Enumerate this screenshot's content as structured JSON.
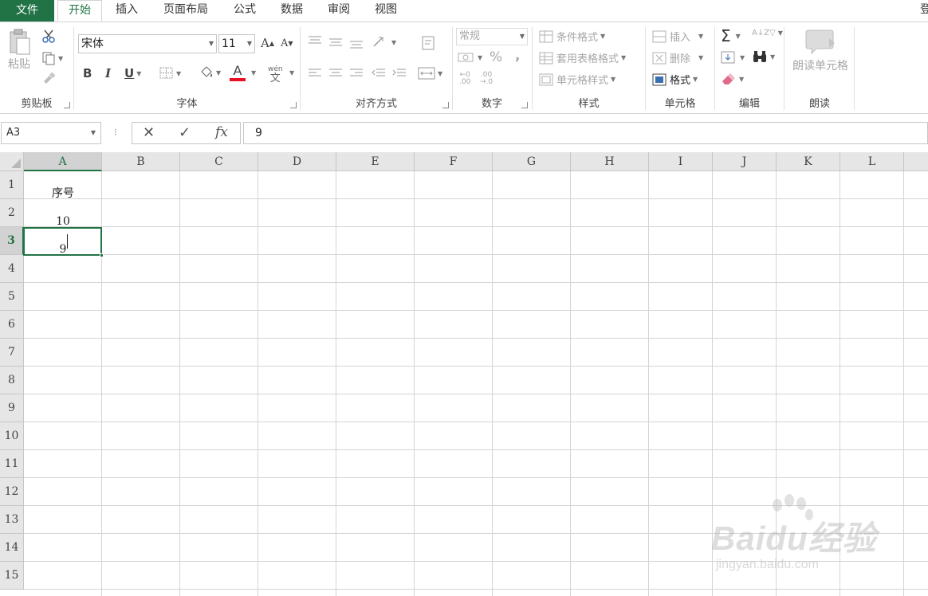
{
  "menu": {
    "file": "文件",
    "tabs": [
      "开始",
      "插入",
      "页面布局",
      "公式",
      "数据",
      "审阅",
      "视图"
    ],
    "active_tab": "开始",
    "login": "登"
  },
  "ribbon": {
    "clipboard": {
      "paste": "粘贴",
      "label": "剪贴板"
    },
    "font": {
      "name": "宋体",
      "size": "11",
      "bold": "B",
      "italic": "I",
      "underline": "U",
      "font_color_glyph": "A",
      "phonetic_glyph": "wén\n文",
      "grow": "A",
      "shrink": "A",
      "label": "字体",
      "font_color": "#e81123"
    },
    "alignment": {
      "label": "对齐方式"
    },
    "number": {
      "format": "常规",
      "percent": "%",
      "comma": ",",
      "label": "数字"
    },
    "styles": {
      "conditional": "条件格式",
      "table": "套用表格格式",
      "cell_styles": "单元格样式",
      "label": "样式"
    },
    "cells": {
      "insert": "插入",
      "delete": "删除",
      "format": "格式",
      "label": "单元格"
    },
    "editing": {
      "sum": "Σ",
      "label": "编辑"
    },
    "read": {
      "read_cell": "朗读单元格",
      "label": "朗读"
    }
  },
  "formula_bar": {
    "name_box": "A3",
    "cancel": "✕",
    "enter": "✓",
    "fx": "fx",
    "value": "9"
  },
  "sheet": {
    "columns": [
      "A",
      "B",
      "C",
      "D",
      "E",
      "F",
      "G",
      "H",
      "I",
      "J",
      "K",
      "L"
    ],
    "rows": [
      "1",
      "2",
      "3",
      "4",
      "5",
      "6",
      "7",
      "8",
      "9",
      "10",
      "11",
      "12",
      "13",
      "14",
      "15"
    ],
    "selected_column": "A",
    "selected_row": "3",
    "cells": {
      "A1": "序号",
      "A2": "10",
      "A3": "9"
    }
  },
  "watermark": {
    "logo": "Baidu经验",
    "url": "jingyan.baidu.com"
  },
  "colors": {
    "accent": "#217346",
    "grid": "#d4d4d4",
    "header_bg": "#e6e6e6"
  }
}
